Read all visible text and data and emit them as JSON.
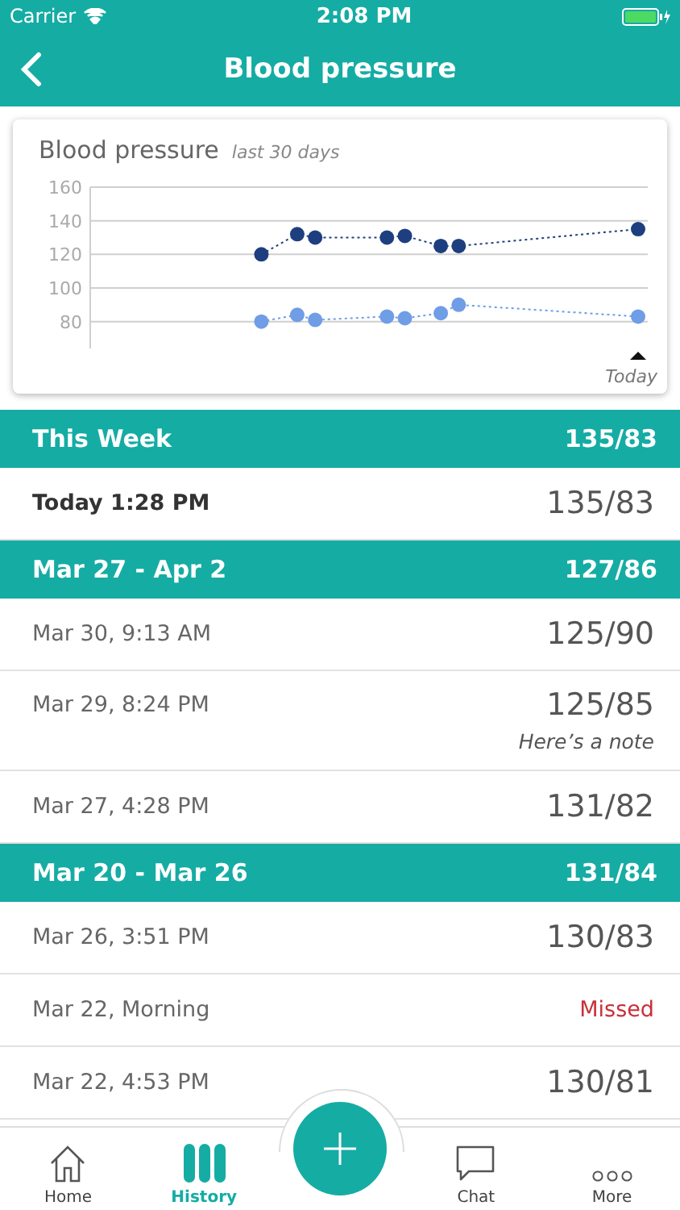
{
  "status_bar": {
    "carrier": "Carrier",
    "time": "2:08 PM"
  },
  "nav": {
    "title": "Blood pressure"
  },
  "chart_card": {
    "title": "Blood pressure",
    "subtitle": "last 30 days",
    "chart_data": {
      "type": "line",
      "categories": [
        null,
        null,
        null,
        null,
        null,
        null,
        null,
        null,
        null,
        null,
        null,
        null,
        null,
        null,
        null,
        null,
        null,
        null,
        null,
        null,
        null,
        null,
        null,
        null,
        null,
        null,
        null,
        null,
        null,
        null,
        null
      ],
      "ylim": [
        64,
        160
      ],
      "yticks": [
        80,
        100,
        120,
        140,
        160
      ],
      "grid": true,
      "annotations": [
        "Today"
      ],
      "series": [
        {
          "color": "#1e3f7f",
          "line_style": "dotted",
          "marker": "circle",
          "values": [
            null,
            null,
            null,
            null,
            null,
            null,
            null,
            null,
            null,
            120,
            null,
            132,
            130,
            null,
            null,
            null,
            130,
            131,
            null,
            125,
            125,
            null,
            null,
            null,
            null,
            null,
            null,
            null,
            null,
            null,
            135
          ]
        },
        {
          "color": "#6f9de6",
          "line_style": "dotted",
          "marker": "circle",
          "values": [
            null,
            null,
            null,
            null,
            null,
            null,
            null,
            null,
            null,
            80,
            null,
            84,
            81,
            null,
            null,
            null,
            83,
            82,
            null,
            85,
            90,
            null,
            null,
            null,
            null,
            null,
            null,
            null,
            null,
            null,
            83
          ]
        }
      ]
    }
  },
  "sections": [
    {
      "title": "This Week",
      "value": "135/83",
      "rows": [
        {
          "kind": "reading",
          "label": "Today 1:28 PM",
          "value": "135/83",
          "current": true
        }
      ]
    },
    {
      "title": "Mar 27 - Apr 2",
      "value": "127/86",
      "rows": [
        {
          "kind": "reading",
          "label": "Mar 30, 9:13 AM",
          "value": "125/90",
          "current": false
        },
        {
          "kind": "reading",
          "label": "Mar 29, 8:24 PM",
          "value": "125/85",
          "note": "Here’s a note",
          "current": false
        },
        {
          "kind": "reading",
          "label": "Mar 27, 4:28 PM",
          "value": "131/82",
          "current": false
        }
      ]
    },
    {
      "title": "Mar 20 - Mar 26",
      "value": "131/84",
      "rows": [
        {
          "kind": "reading",
          "label": "Mar 26, 3:51 PM",
          "value": "130/83",
          "current": false
        },
        {
          "kind": "missed",
          "label": "Mar 22, Morning",
          "value": "Missed",
          "current": false
        },
        {
          "kind": "reading",
          "label": "Mar 22, 4:53 PM",
          "value": "130/81",
          "current": false
        }
      ]
    }
  ],
  "tab_bar": [
    {
      "kind": "home",
      "label": "Home",
      "selected": false
    },
    {
      "kind": "history",
      "label": "History",
      "selected": true
    },
    {
      "kind": "add"
    },
    {
      "kind": "chat",
      "label": "Chat",
      "selected": false
    },
    {
      "kind": "more",
      "label": "More",
      "selected": false
    }
  ]
}
